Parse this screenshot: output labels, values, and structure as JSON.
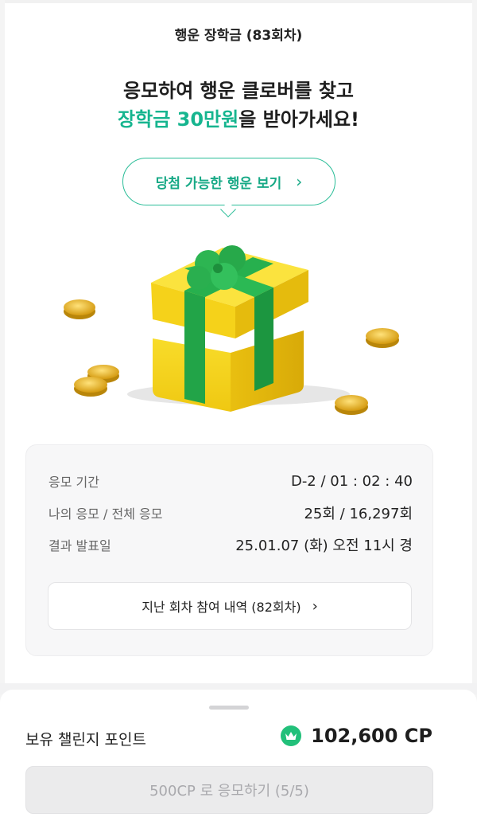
{
  "header": {
    "title": "행운 장학금 (83회차)"
  },
  "hero": {
    "line1": "응모하여 행운 클로버를 찾고",
    "line2_accent": "장학금 30만원",
    "line2_rest": "을 받아가세요!"
  },
  "lucky_button": {
    "label": "당첨 가능한 행운 보기",
    "chevron": "›"
  },
  "illustration": {
    "name": "gift-box-with-clover",
    "colors": {
      "box": "#f5d21a",
      "ribbon": "#22a448",
      "coin": "#e0a81a"
    }
  },
  "info": {
    "rows": [
      {
        "label": "응모 기간",
        "value": "D-2 / 01 : 02 : 40"
      },
      {
        "label": "나의 응모 / 전체 응모",
        "value": "25회 / 16,297회"
      },
      {
        "label": "결과 발표일",
        "value": "25.01.07 (화) 오전 11시 경"
      }
    ],
    "history_button": {
      "label": "지난 회차 참여 내역 (82회차)",
      "chevron": "›"
    }
  },
  "points": {
    "label": "보유 챌린지 포인트",
    "value": "102,600 CP",
    "icon": "crown-coin-icon"
  },
  "apply_button": {
    "label": "500CP 로 응모하기 (5/5)",
    "disabled": true
  },
  "colors": {
    "accent": "#16b58f",
    "point_icon": "#22c07a"
  }
}
